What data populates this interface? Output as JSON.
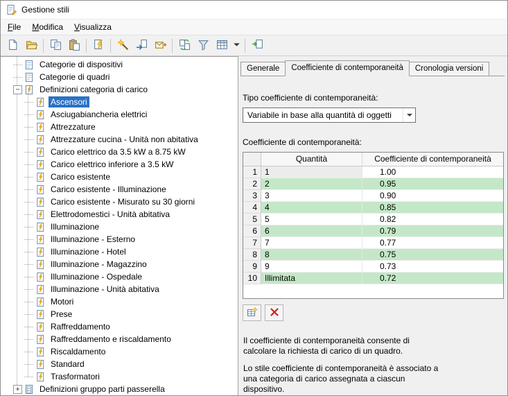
{
  "window": {
    "title": "Gestione stili"
  },
  "menu": {
    "items": [
      {
        "id": "file",
        "label": "File"
      },
      {
        "id": "modifica",
        "label": "Modifica"
      },
      {
        "id": "visualizza",
        "label": "Visualizza"
      }
    ]
  },
  "toolbar": {
    "buttons": [
      {
        "name": "new-drawing",
        "icon": "new-file-icon"
      },
      {
        "name": "open-drawing",
        "icon": "open-folder-icon"
      },
      {
        "separator": true
      },
      {
        "name": "copy",
        "icon": "copy-icon"
      },
      {
        "name": "paste",
        "icon": "paste-icon"
      },
      {
        "separator": true
      },
      {
        "name": "purge-styles",
        "icon": "purge-icon"
      },
      {
        "separator": true
      },
      {
        "name": "new-style",
        "icon": "new-style-icon"
      },
      {
        "name": "set-from",
        "icon": "set-from-icon"
      },
      {
        "name": "send-styles",
        "icon": "send-icon"
      },
      {
        "separator": true
      },
      {
        "name": "synchronize-styles",
        "icon": "sync-icon"
      },
      {
        "name": "filter-style-type",
        "icon": "filter-icon"
      },
      {
        "name": "toggle-view",
        "icon": "table-view-icon"
      },
      {
        "name": "view-options",
        "icon": "chevron-down-icon"
      },
      {
        "separator": true
      },
      {
        "name": "inline-edit",
        "icon": "inline-edit-icon"
      }
    ]
  },
  "tree": {
    "items": [
      {
        "label": "Categorie di dispositivi",
        "level": 1,
        "icon": "device-category-icon",
        "selected": false
      },
      {
        "label": "Categorie di quadri",
        "level": 1,
        "icon": "panel-category-icon",
        "selected": false
      },
      {
        "label": "Definizioni categoria di carico",
        "level": 1,
        "icon": "load-category-icon",
        "expand": "minus",
        "selected": false
      },
      {
        "label": "Ascensori",
        "level": 2,
        "icon": "style-icon",
        "selected": true
      },
      {
        "label": "Asciugabiancheria elettrici",
        "level": 2,
        "icon": "style-icon",
        "selected": false
      },
      {
        "label": "Attrezzature",
        "level": 2,
        "icon": "style-icon",
        "selected": false
      },
      {
        "label": "Attrezzature cucina - Unità non abitativa",
        "level": 2,
        "icon": "style-icon",
        "selected": false
      },
      {
        "label": "Carico elettrico da 3.5 kW a 8.75 kW",
        "level": 2,
        "icon": "style-icon",
        "selected": false
      },
      {
        "label": "Carico elettrico inferiore a 3.5 kW",
        "level": 2,
        "icon": "style-icon",
        "selected": false
      },
      {
        "label": "Carico esistente",
        "level": 2,
        "icon": "style-icon",
        "selected": false
      },
      {
        "label": "Carico esistente - Illuminazione",
        "level": 2,
        "icon": "style-icon",
        "selected": false
      },
      {
        "label": "Carico esistente - Misurato su 30 giorni",
        "level": 2,
        "icon": "style-icon",
        "selected": false
      },
      {
        "label": "Elettrodomestici - Unità abitativa",
        "level": 2,
        "icon": "style-icon",
        "selected": false
      },
      {
        "label": "Illuminazione",
        "level": 2,
        "icon": "style-icon",
        "selected": false
      },
      {
        "label": "Illuminazione - Esterno",
        "level": 2,
        "icon": "style-icon",
        "selected": false
      },
      {
        "label": "Illuminazione - Hotel",
        "level": 2,
        "icon": "style-icon",
        "selected": false
      },
      {
        "label": "Illuminazione - Magazzino",
        "level": 2,
        "icon": "style-icon",
        "selected": false
      },
      {
        "label": "Illuminazione - Ospedale",
        "level": 2,
        "icon": "style-icon",
        "selected": false
      },
      {
        "label": "Illuminazione - Unità abitativa",
        "level": 2,
        "icon": "style-icon",
        "selected": false
      },
      {
        "label": "Motori",
        "level": 2,
        "icon": "style-icon",
        "selected": false
      },
      {
        "label": "Prese",
        "level": 2,
        "icon": "style-icon",
        "selected": false
      },
      {
        "label": "Raffreddamento",
        "level": 2,
        "icon": "style-icon",
        "selected": false
      },
      {
        "label": "Raffreddamento e riscaldamento",
        "level": 2,
        "icon": "style-icon",
        "selected": false
      },
      {
        "label": "Riscaldamento",
        "level": 2,
        "icon": "style-icon",
        "selected": false
      },
      {
        "label": "Standard",
        "level": 2,
        "icon": "style-icon",
        "selected": false
      },
      {
        "label": "Trasformatori",
        "level": 2,
        "icon": "style-icon",
        "selected": false
      },
      {
        "label": "Definizioni gruppo parti passerella",
        "level": 1,
        "icon": "cable-tray-icon",
        "expand": "plus",
        "selected": false
      }
    ]
  },
  "tabs": [
    {
      "id": "generale",
      "label": "Generale",
      "active": false
    },
    {
      "id": "coefficiente",
      "label": "Coefficiente di contemporaneità",
      "active": true
    },
    {
      "id": "cronologia",
      "label": "Cronologia versioni",
      "active": false
    }
  ],
  "panel": {
    "type_label": "Tipo coefficiente di contemporaneità:",
    "type_value": "Variabile in base alla quantità di oggetti",
    "table_label": "Coefficiente di contemporaneità:",
    "table": {
      "columns": [
        "Quantità",
        "Coefficiente di contemporaneità"
      ],
      "rows": [
        {
          "num": "1",
          "quantity": "1",
          "coefficient": "1.00",
          "highlight": false,
          "active": true
        },
        {
          "num": "2",
          "quantity": "2",
          "coefficient": "0.95",
          "highlight": true
        },
        {
          "num": "3",
          "quantity": "3",
          "coefficient": "0.90",
          "highlight": false
        },
        {
          "num": "4",
          "quantity": "4",
          "coefficient": "0.85",
          "highlight": true
        },
        {
          "num": "5",
          "quantity": "5",
          "coefficient": "0.82",
          "highlight": false
        },
        {
          "num": "6",
          "quantity": "6",
          "coefficient": "0.79",
          "highlight": true
        },
        {
          "num": "7",
          "quantity": "7",
          "coefficient": "0.77",
          "highlight": false
        },
        {
          "num": "8",
          "quantity": "8",
          "coefficient": "0.75",
          "highlight": true
        },
        {
          "num": "9",
          "quantity": "9",
          "coefficient": "0.73",
          "highlight": false
        },
        {
          "num": "10",
          "quantity": "Illimitata",
          "coefficient": "0.72",
          "highlight": true
        }
      ]
    },
    "description1": "Il coefficiente di contemporaneità consente di calcolare la richiesta di carico di un quadro.",
    "description2": "Lo stile coefficiente di contemporaneità è associato a una categoria di carico assegnata a ciascun dispositivo."
  },
  "colors": {
    "selection": "#2a72c7",
    "row_highlight": "#c4e8c7",
    "window_chrome": "#f0f0f0"
  }
}
